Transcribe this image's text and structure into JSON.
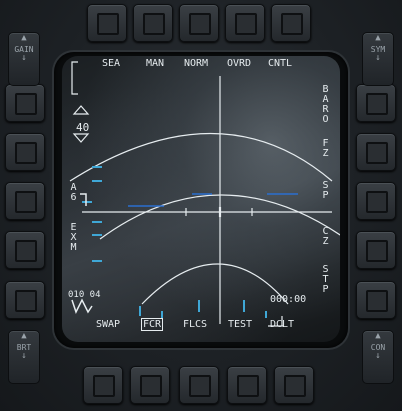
{
  "top_menu": [
    "SEA",
    "MAN",
    "NORM",
    "OVRD",
    "CNTL"
  ],
  "bottom_menu": [
    "SWAP",
    "FCR",
    "FLCS",
    "TEST",
    "DCLT"
  ],
  "bottom_selected": "FCR",
  "right_labels": [
    "BARO",
    "FZ",
    "SP",
    "CZ",
    "STP"
  ],
  "left_labels": [
    "A6",
    "EXM"
  ],
  "range_value": "40",
  "readout_left": "010 04",
  "readout_right": "000:00",
  "rockers": {
    "gain": "GAIN",
    "sym": "SYM",
    "brt": "BRT",
    "con": "CON"
  },
  "colors": {
    "symbology": "#e6ecef",
    "cyan": "#3fa7d6",
    "blue": "#2a6fd0"
  }
}
